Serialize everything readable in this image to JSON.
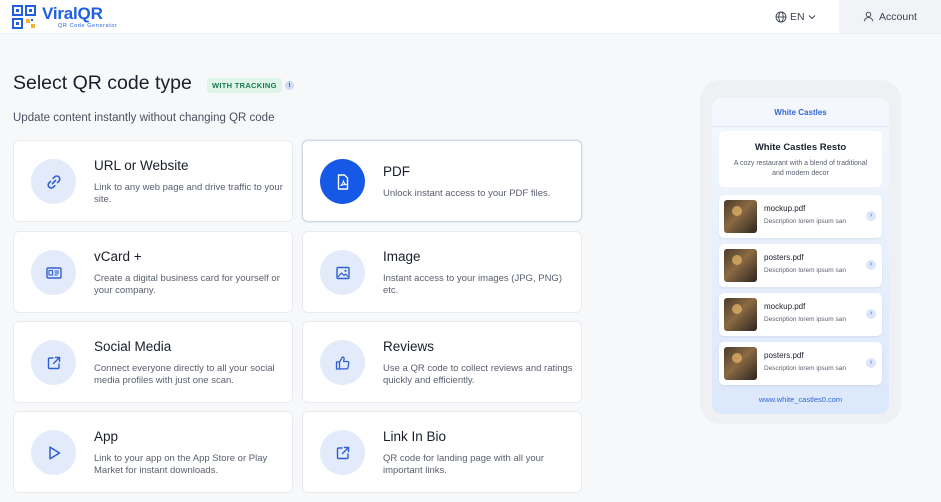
{
  "header": {
    "brand": "ViralQR",
    "tagline": "QR Code Generator",
    "language": "EN",
    "account_label": "Account"
  },
  "main": {
    "title": "Select QR code type",
    "badge": "WITH TRACKING",
    "info": "i",
    "subtitle": "Update content instantly without changing QR code"
  },
  "types": [
    {
      "title": "URL or Website",
      "desc": "Link to any web page and drive traffic to your site.",
      "icon": "link-icon",
      "selected": false
    },
    {
      "title": "PDF",
      "desc": "Unlock instant access to your PDF files.",
      "icon": "pdf-icon",
      "selected": true
    },
    {
      "title": "vCard +",
      "desc": "Create a digital business card for yourself or your company.",
      "icon": "id-card-icon",
      "selected": false
    },
    {
      "title": "Image",
      "desc": "Instant access to your images (JPG, PNG) etc.",
      "icon": "image-icon",
      "selected": false
    },
    {
      "title": "Social Media",
      "desc": "Connect everyone directly to all your social media profiles with just one scan.",
      "icon": "share-icon",
      "selected": false
    },
    {
      "title": "Reviews",
      "desc": "Use a QR code to collect reviews and ratings quickly and efficiently.",
      "icon": "thumbs-up-icon",
      "selected": false
    },
    {
      "title": "App",
      "desc": "Link to your app on the App Store or Play Market for instant downloads.",
      "icon": "play-icon",
      "selected": false
    },
    {
      "title": "Link In Bio",
      "desc": "QR code for landing page with all your important links.",
      "icon": "share-icon",
      "selected": false
    }
  ],
  "preview": {
    "header": "White Castles",
    "name": "White Castles Resto",
    "description": "A cozy restaurant with a blend of traditional and modern decor",
    "files": [
      {
        "name": "mockup.pdf",
        "desc": "Description lorem ipsum san"
      },
      {
        "name": "posters.pdf",
        "desc": "Description lorem ipsum san"
      },
      {
        "name": "mockup.pdf",
        "desc": "Description lorem ipsum san"
      },
      {
        "name": "posters.pdf",
        "desc": "Description lorem ipsum san"
      }
    ],
    "url": "www.white_castles0.com"
  },
  "colors": {
    "brand": "#1f5fe0",
    "selected_icon_bg": "#1659e6",
    "icon_bg": "#e3ebfb",
    "icon_stroke": "#2f5fd2",
    "badge_bg": "#dff5ea",
    "badge_text": "#1a7a4c"
  }
}
